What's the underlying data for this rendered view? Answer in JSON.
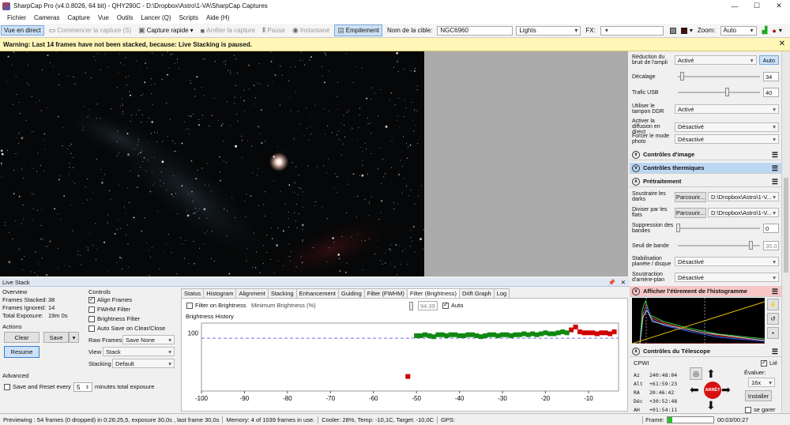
{
  "window": {
    "title": "SharpCap Pro (v4.0.8026, 64 bit) - QHY290C - D:\\Dropbox\\Astro\\1-VA\\SharpCap Captures",
    "minimize": "—",
    "maximize": "☐",
    "close": "✕"
  },
  "menu": [
    "Fichier",
    "Cameras",
    "Capture",
    "Vue",
    "Outils",
    "Lancer (Q)",
    "Scripts",
    "Aide (H)"
  ],
  "toolbar": {
    "live": "Vue en direct",
    "start": "Commencer la capture (S)",
    "quick": "Capture rapide",
    "stop": "Arrêter la capture",
    "pause": "Pause",
    "snapshot": "Instantané",
    "stack": "Empilement",
    "target_label": "Nom de la cible:",
    "target": "NGC6960",
    "frame_type": "Lights",
    "fx_label": "FX:",
    "zoom_label": "Zoom:",
    "zoom": "Auto"
  },
  "warning": "Warning: Last 14 frames have not been stacked, because: Live Stacking is paused.",
  "right": {
    "gain_red": {
      "label": "Réduction du bruit de l'ampli",
      "value": "Activé",
      "btn": "Auto"
    },
    "offset": {
      "label": "Décalage",
      "value": "34"
    },
    "usb": {
      "label": "Trafic USB",
      "value": "40"
    },
    "ddr": {
      "label": "Utiliser le tampon DDR",
      "value": "Activé"
    },
    "live_diff": {
      "label": "Activer la diffusion en direct",
      "value": "Désactivé"
    },
    "photo": {
      "label": "Forcer le mode photo",
      "value": "Désactivé"
    },
    "sec_image": "Contrôles d'image",
    "sec_thermal": "Contrôles thermiques",
    "sec_pre": "Prétraitement",
    "darks": {
      "label": "Soustraire les darks",
      "btn": "Parcourir...",
      "value": "D:\\Dropbox\\Astro\\1-V..."
    },
    "flats": {
      "label": "Diviser par les flats",
      "btn": "Parcourir...",
      "value": "D:\\Dropbox\\Astro\\1-V..."
    },
    "banding": {
      "label": "Suppression des bandes",
      "value": "0"
    },
    "band_thr": {
      "label": "Seuil de bande",
      "value": "35.0"
    },
    "stab": {
      "label": "Stabilisation planète / disque",
      "value": "Désactivé"
    },
    "bg_sub": {
      "label": "Soustraction d'arrière-plan",
      "value": "Désactivé"
    },
    "sec_hist": "Afficher l'étirement de l'histogramme",
    "sec_tel": "Contrôles du Télescope",
    "tel": {
      "name": "CPWI",
      "linked": "Lié",
      "az": "240:48:04",
      "alt": "+61:59:23",
      "ra": "20:46:42",
      "dec": "+30:52:48",
      "ah": "+01:54:11",
      "az_l": "Az",
      "alt_l": "Alt",
      "ra_l": "RA",
      "dec_l": "Déc",
      "ah_l": "AH",
      "rate_label": "Évaluer:",
      "rate": "16x",
      "install": "Installer",
      "park": "se garer",
      "stop": "ARRÊT"
    }
  },
  "live": {
    "header": "Live Stack",
    "overview": "Overview",
    "stacked_l": "Frames Stacked:",
    "stacked": "38",
    "ignored_l": "Frames Ignored:",
    "ignored": "14",
    "exposure_l": "Total Exposure:",
    "exposure": "19m 0s",
    "actions": "Actions",
    "clear": "Clear",
    "save": "Save",
    "resume": "Resume",
    "advanced": "Advanced",
    "save_reset": "Save and Reset every",
    "minutes": "5",
    "min_label": "minutes total exposure",
    "controls": "Controls",
    "align": "Align Frames",
    "fwhm": "FWHM Filter",
    "bright": "Brightness Filter",
    "autosave": "Auto Save on Clear/Close",
    "raw_l": "Raw Frames",
    "raw": "Save None",
    "view_l": "View",
    "view": "Stack",
    "stacking_l": "Stacking",
    "stacking": "Default"
  },
  "tabs": [
    "Status",
    "Histogram",
    "Alignment",
    "Stacking",
    "Enhancement",
    "Guiding",
    "Filter (FWHM)",
    "Filter (Brightness)",
    "Drift Graph",
    "Log"
  ],
  "filter": {
    "enable": "Filter on Brightness",
    "min_label": "Minimum Brightness (%)",
    "min": "94.39",
    "auto": "Auto",
    "graph_title": "Brightness History"
  },
  "chart_data": {
    "type": "scatter",
    "x_ticks": [
      -100,
      -90,
      -80,
      -70,
      -60,
      -50,
      -40,
      -30,
      -20,
      -10,
      0
    ],
    "y_ticks": [
      100
    ],
    "xlim": [
      -100,
      -3
    ],
    "ylim": [
      40,
      110
    ],
    "threshold": 94.39,
    "series": [
      {
        "color": "#d00000",
        "x": [
          -52,
          -14,
          -13,
          -12,
          -11,
          -10,
          -9,
          -8,
          -7,
          -6,
          -5,
          -4
        ],
        "y": [
          55,
          103,
          106,
          101,
          100,
          100,
          100,
          99,
          100,
          100,
          99,
          101
        ]
      },
      {
        "color": "#118811",
        "x": [
          -50,
          -49,
          -48,
          -47,
          -46,
          -45,
          -44,
          -43,
          -42,
          -41,
          -40,
          -39,
          -38,
          -37,
          -36,
          -35,
          -34,
          -33,
          -32,
          -31,
          -30,
          -29,
          -28,
          -27,
          -26,
          -25,
          -24,
          -23,
          -22,
          -21,
          -20,
          -19,
          -18,
          -17,
          -16,
          -15
        ],
        "y": [
          97,
          97,
          98,
          97,
          96,
          98,
          98,
          97,
          98,
          98,
          97,
          97,
          98,
          98,
          97,
          96,
          97,
          98,
          98,
          97,
          98,
          98,
          97,
          98,
          98,
          99,
          98,
          99,
          98,
          99,
          100,
          99,
          99,
          100,
          101,
          100
        ]
      }
    ]
  },
  "status": {
    "preview": "Previewing : 54 frames (0 dropped) in 0:26:25,5, exposure 30,0s , last frame 30,0s",
    "memory": "Memory: 4 of 1039 frames in use.",
    "cooler": "Cooler: 28%, Temp: -10,1C, Target: -10,0C",
    "gps": "GPS:",
    "frame": "Frame:",
    "time": "00:03/00:27"
  }
}
